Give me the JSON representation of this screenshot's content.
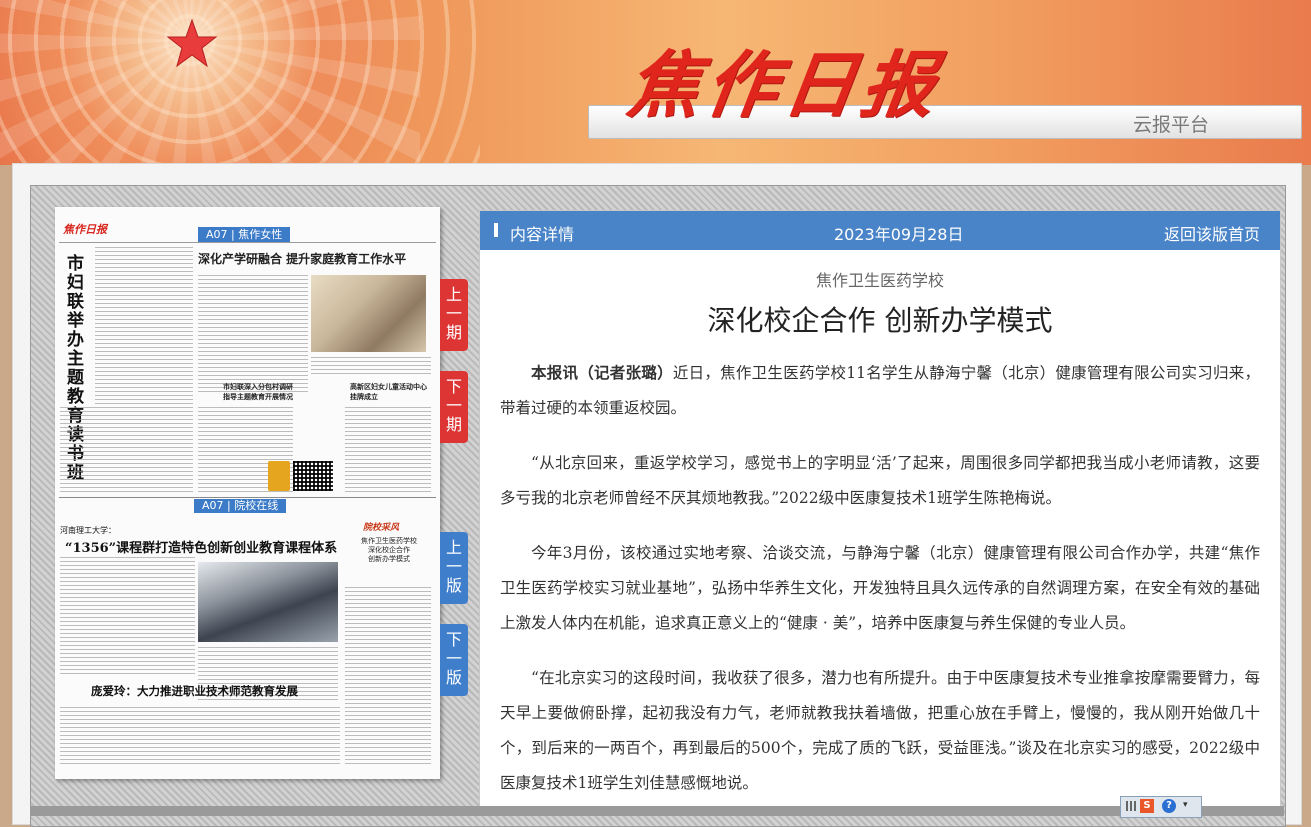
{
  "header": {
    "logo_text": "焦作日报",
    "platform_label": "云报平台"
  },
  "paper": {
    "mini_logo": "焦作日报",
    "edition_top": "A07 | 焦作女性",
    "edition_bottom": "A07 | 院校在线",
    "headline_top": "深化产学研融合  提升家庭教育工作水平",
    "vertical_headline": "市妇联举办主题教育读书班",
    "small_headline_1": "市妇联深入分包村调研\n指导主题教育开展情况",
    "small_headline_2": "高新区妇女儿童活动中心\n挂牌成立",
    "school_line": "河南理工大学：",
    "headline_middle": "“1356”课程群打造特色创新创业教育课程体系",
    "headline_bottom": "庞爱玲：大力推进职业技术师范教育发展",
    "column_logo": "院校采风",
    "side_box": "焦作卫生医药学校\n深化校企合作\n创新办学模式"
  },
  "nav": {
    "prev_issue": "上一期",
    "next_issue": "下一期",
    "prev_page": "上一版",
    "next_page": "下一版"
  },
  "panel": {
    "header_title": "内容详情",
    "date": "2023年09月28日",
    "back_label": "返回该版首页",
    "subhead": "焦作卫生医药学校",
    "title": "深化校企合作 创新办学模式",
    "lead": "本报讯（记者张璐）",
    "paragraphs": [
      "近日，焦作卫生医药学校11名学生从静海宁馨（北京）健康管理有限公司实习归来，带着过硬的本领重返校园。",
      "“从北京回来，重返学校学习，感觉书上的字明显‘活’了起来，周围很多同学都把我当成小老师请教，这要多亏我的北京老师曾经不厌其烦地教我。”2022级中医康复技术1班学生陈艳梅说。",
      "今年3月份，该校通过实地考察、洽谈交流，与静海宁馨（北京）健康管理有限公司合作办学，共建“焦作卫生医药学校实习就业基地”，弘扬中华养生文化，开发独特且具久远传承的自然调理方案，在安全有效的基础上激发人体内在机能，追求真正意义上的“健康 · 美”，培养中医康复与养生保健的专业人员。",
      "“在北京实习的这段时间，我收获了很多，潜力也有所提升。由于中医康复技术专业推拿按摩需要臂力，每天早上要做俯卧撑，起初我没有力气，老师就教我扶着墙做，把重心放在手臂上，慢慢的，我从刚开始做几十个，到后来的一两百个，再到最后的500个，完成了质的飞跃，受益匪浅。”谈及在北京实习的感受，2022级中医康复技术1班学生刘佳慧感慨地说。"
    ]
  },
  "tray": {
    "s_label": "S",
    "help_label": "?"
  },
  "colors": {
    "accent_blue": "#4a84c8",
    "nav_red": "#dd3434",
    "nav_blue": "#3f7ecb",
    "logo_red": "#e0251d"
  }
}
